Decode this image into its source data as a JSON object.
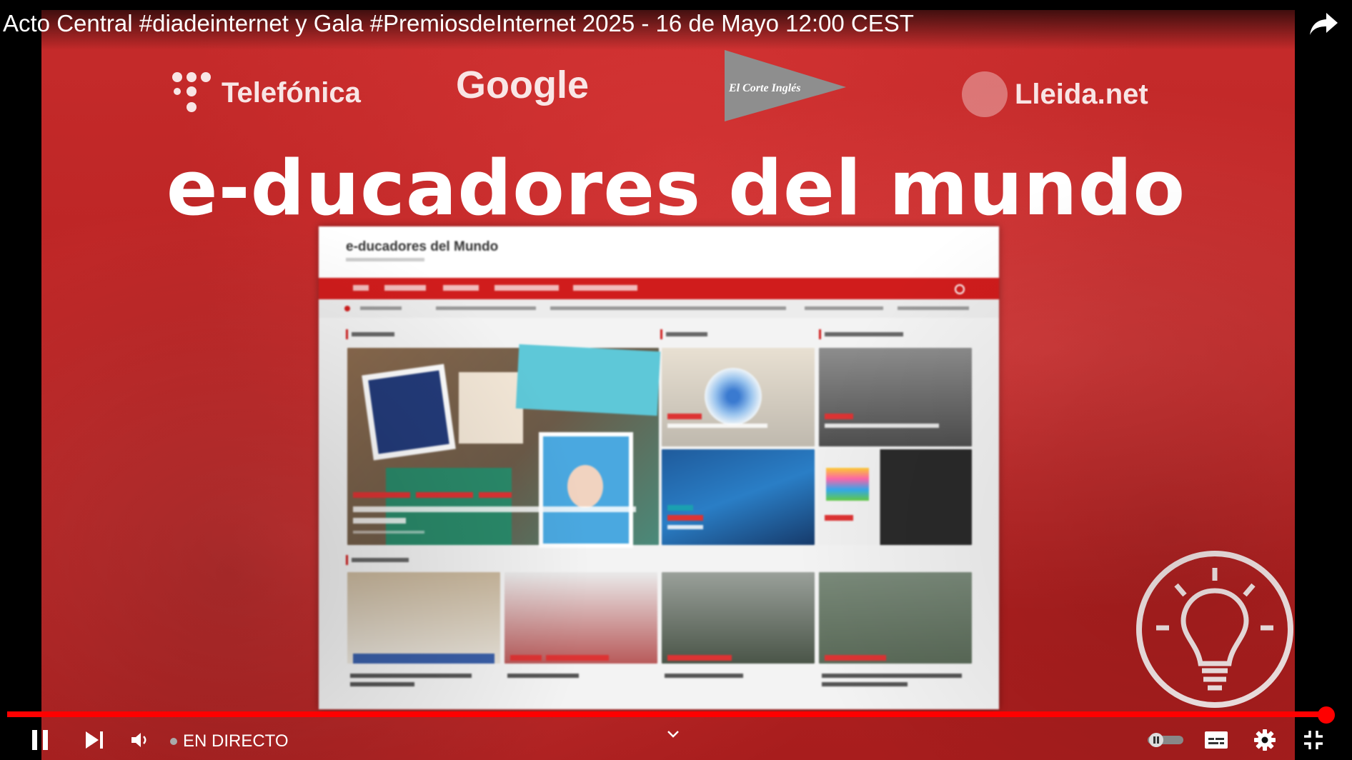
{
  "player": {
    "title": "Acto Central #diadeinternet y Gala #PremiosdeInternet 2025 - 16 de Mayo 12:00 CEST",
    "live_label": "EN DIRECTO",
    "progress": 0.9956
  },
  "slide": {
    "sponsors": {
      "telefonica": "Telefónica",
      "google": "Google",
      "el_corte_ingles": "El Corte Inglés",
      "lleida": "Lleida.net"
    },
    "headline": "e-ducadores del mundo",
    "website": {
      "site_title": "e-ducadores del Mundo"
    }
  },
  "colors": {
    "slide_red": "#c62b2b",
    "progress_red": "#ff0000",
    "site_nav_red": "#d01c1c"
  },
  "icons": [
    "share-icon",
    "pause-icon",
    "next-icon",
    "volume-icon",
    "chevron-down-icon",
    "autoplay-toggle-icon",
    "subtitles-icon",
    "settings-icon",
    "exit-fullscreen-icon",
    "lightbulb-icon"
  ]
}
